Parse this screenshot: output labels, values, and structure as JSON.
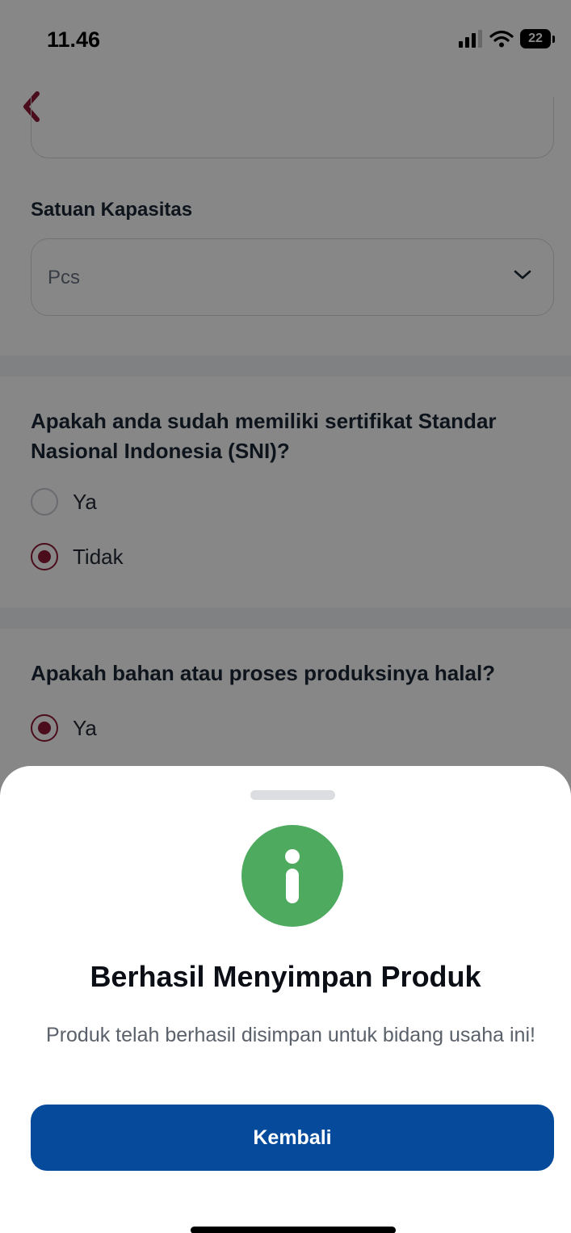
{
  "status_bar": {
    "time": "11.46",
    "battery": "22"
  },
  "form": {
    "capacity_unit_label": "Satuan Kapasitas",
    "capacity_unit_value": "Pcs",
    "sni_question": "Apakah anda sudah memiliki sertifikat Standar Nasional Indonesia (SNI)?",
    "sni_options": [
      {
        "label": "Ya",
        "selected": false
      },
      {
        "label": "Tidak",
        "selected": true
      }
    ],
    "halal_question": "Apakah bahan atau proses produksinya halal?",
    "halal_options": [
      {
        "label": "Ya",
        "selected": true
      }
    ]
  },
  "modal": {
    "icon": "info-icon",
    "title": "Berhasil Menyimpan Produk",
    "message": "Produk telah berhasil disimpan untuk bidang usaha ini!",
    "button_label": "Kembali"
  },
  "colors": {
    "accent": "#8f1a34",
    "primary_button": "#064b9b",
    "info_green": "#4daa5f"
  }
}
